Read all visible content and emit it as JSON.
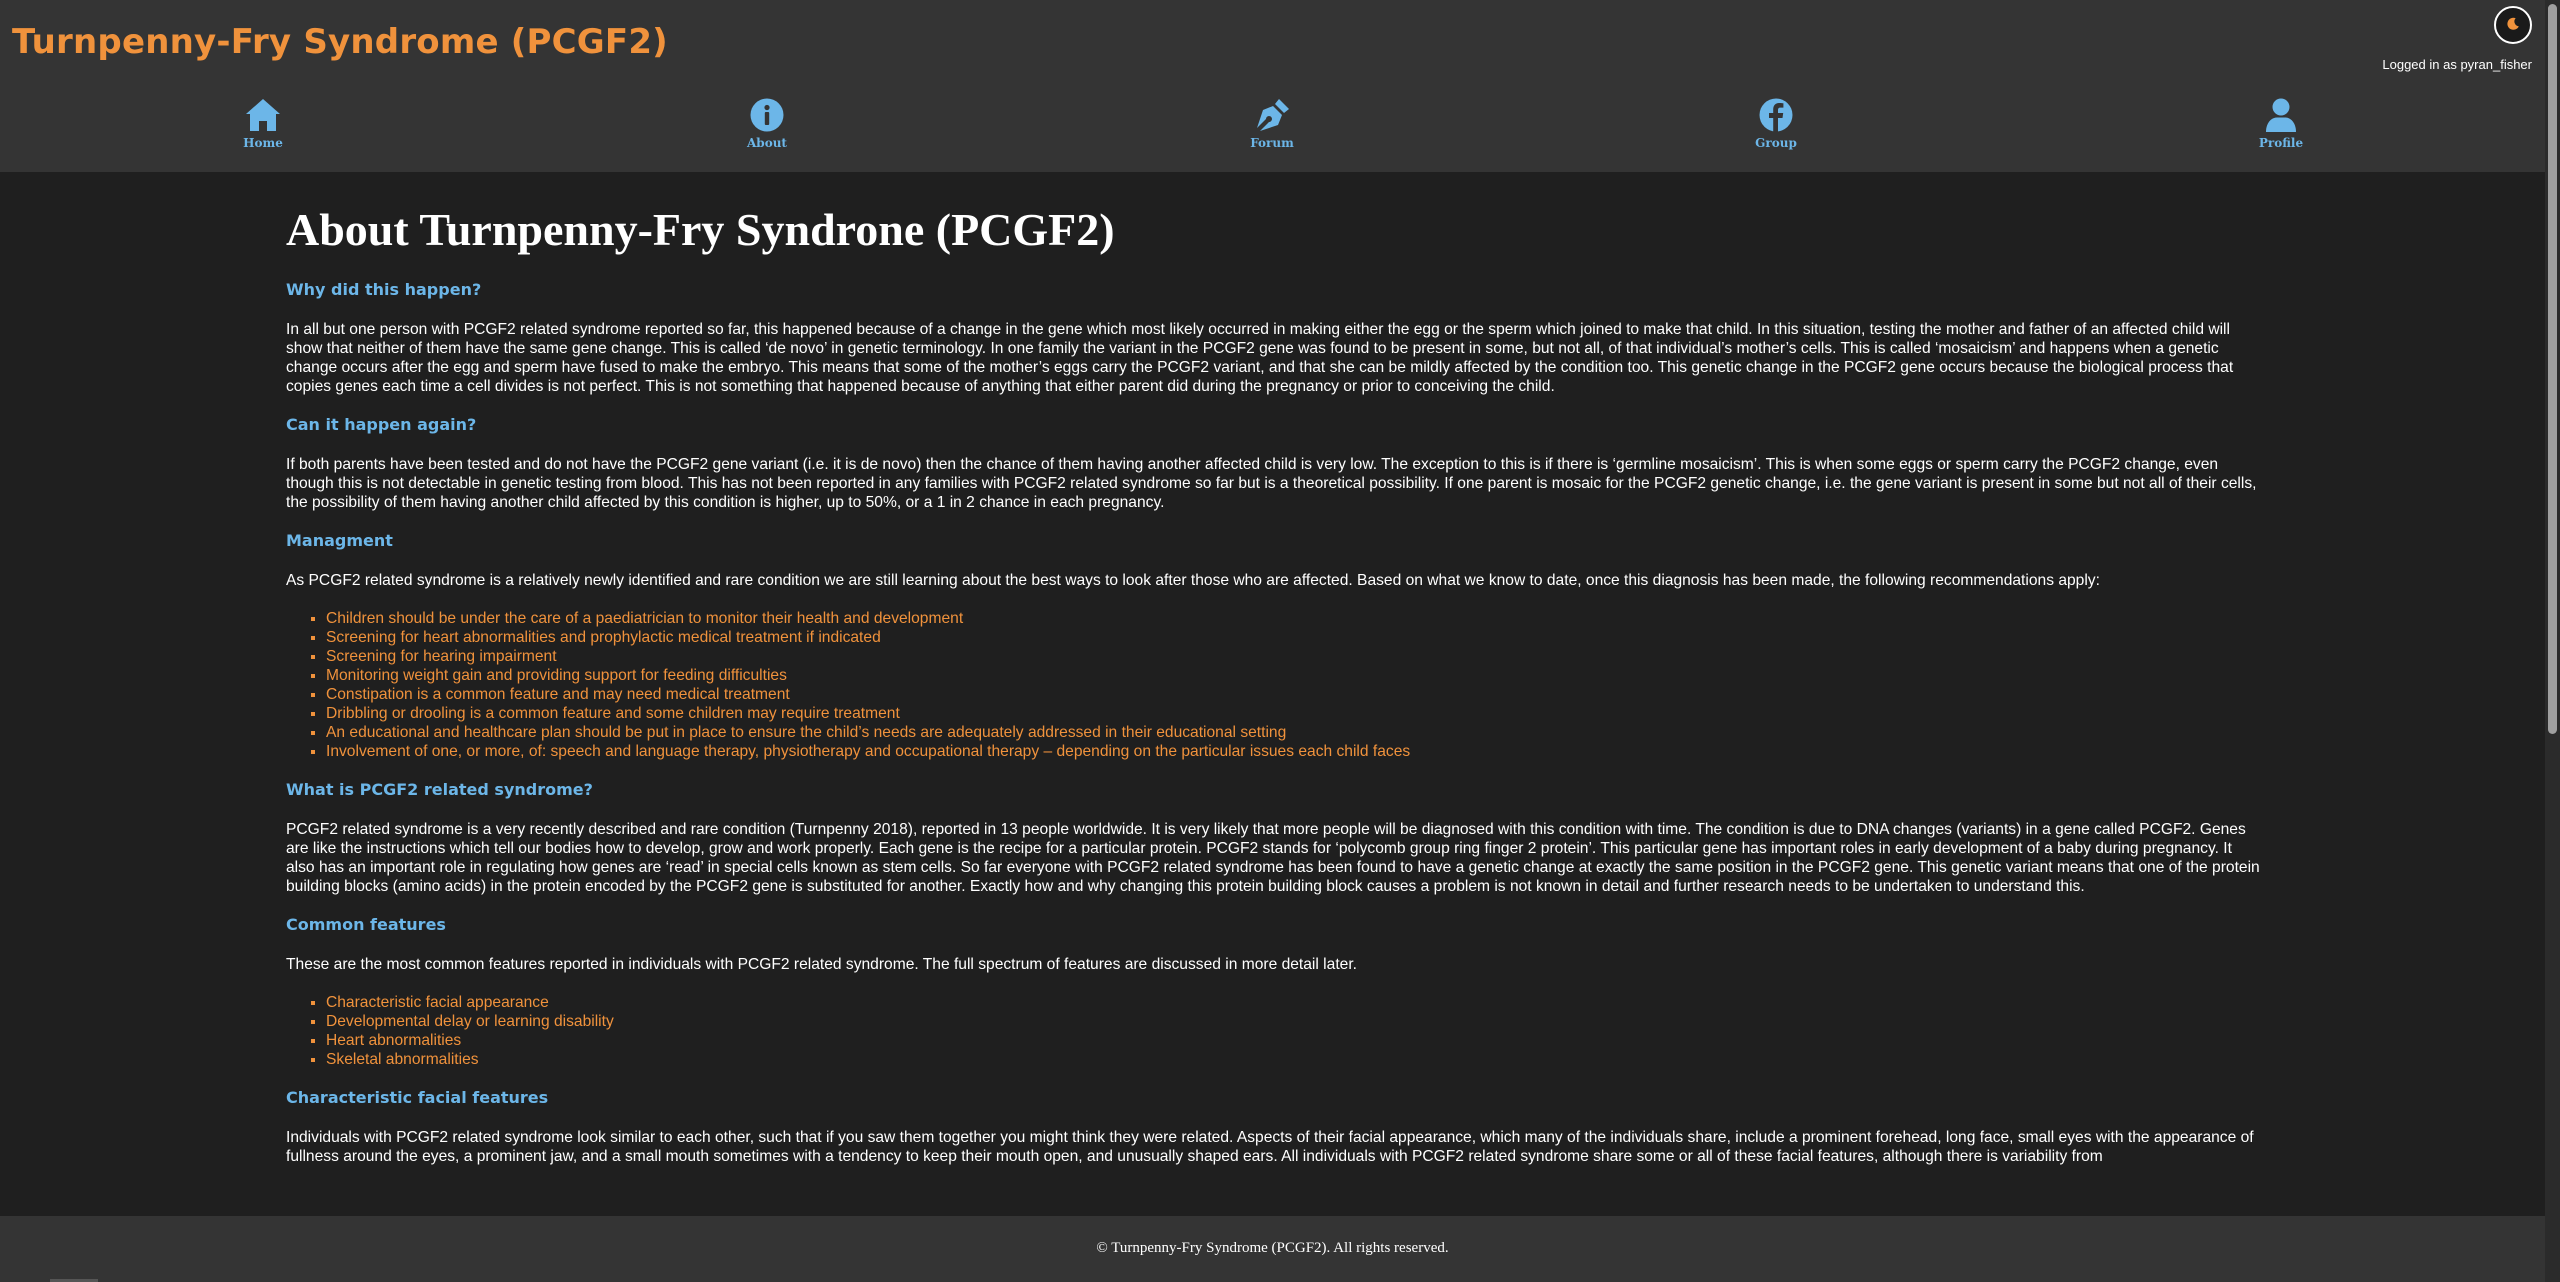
{
  "site": {
    "title": "Turnpenny-Fry Syndrome (PCGF2)",
    "logged_in_text": "Logged in as pyran_fisher",
    "theme_toggle_icon": "moon-icon",
    "accent_color": "#f0923c",
    "link_color": "#6cb6e8"
  },
  "nav": {
    "items": [
      {
        "label": "Home",
        "icon": "home-icon"
      },
      {
        "label": "About",
        "icon": "info-icon"
      },
      {
        "label": "Forum",
        "icon": "pen-nib-icon"
      },
      {
        "label": "Group",
        "icon": "facebook-icon"
      },
      {
        "label": "Profile",
        "icon": "user-icon"
      }
    ]
  },
  "page": {
    "title": "About Turnpenny-Fry Syndrone (PCGF2)",
    "sections": {
      "why": {
        "heading": "Why did this happen?",
        "text": "In all but one person with PCGF2 related syndrome reported so far, this happened because of a change in the gene which most likely occurred in making either the egg or the sperm which joined to make that child. In this situation, testing the mother and father of an affected child will show that neither of them have the same gene change. This is called ‘de novo’ in genetic terminology. In one family the variant in the PCGF2 gene was found to be present in some, but not all, of that individual’s mother’s cells. This is called ‘mosaicism’ and happens when a genetic change occurs after the egg and sperm have fused to make the embryo. This means that some of the mother’s eggs carry the PCGF2 variant, and that she can be mildly affected by the condition too. This genetic change in the PCGF2 gene occurs because the biological process that copies genes each time a cell divides is not perfect. This is not something that happened because of anything that either parent did during the pregnancy or prior to conceiving the child."
      },
      "again": {
        "heading": "Can it happen again?",
        "text": "If both parents have been tested and do not have the PCGF2 gene variant (i.e. it is de novo) then the chance of them having another affected child is very low. The exception to this is if there is ‘germline mosaicism’. This is when some eggs or sperm carry the PCGF2 change, even though this is not detectable in genetic testing from blood. This has not been reported in any families with PCGF2 related syndrome so far but is a theoretical possibility. If one parent is mosaic for the PCGF2 genetic change, i.e. the gene variant is present in some but not all of their cells, the possibility of them having another child affected by this condition is higher, up to 50%, or a 1 in 2 chance in each pregnancy."
      },
      "management": {
        "heading": "Managment",
        "text": "As PCGF2 related syndrome is a relatively newly identified and rare condition we are still learning about the best ways to look after those who are affected. Based on what we know to date, once this diagnosis has been made, the following recommendations apply:",
        "items": [
          "Children should be under the care of a paediatrician to monitor their health and development",
          "Screening for heart abnormalities and prophylactic medical treatment if indicated",
          "Screening for hearing impairment",
          "Monitoring weight gain and providing support for feeding difficulties",
          "Constipation is a common feature and may need medical treatment",
          "Dribbling or drooling is a common feature and some children may require treatment",
          "An educational and healthcare plan should be put in place to ensure the child’s needs are adequately addressed in their educational setting",
          "Involvement of one, or more, of: speech and language therapy, physiotherapy and occupational therapy – depending on the particular issues each child faces"
        ]
      },
      "what": {
        "heading": "What is PCGF2 related syndrome?",
        "text": "PCGF2 related syndrome is a very recently described and rare condition (Turnpenny 2018), reported in 13 people worldwide. It is very likely that more people will be diagnosed with this condition with time. The condition is due to DNA changes (variants) in a gene called PCGF2. Genes are like the instructions which tell our bodies how to develop, grow and work properly. Each gene is the recipe for a particular protein. PCGF2 stands for ‘polycomb group ring finger 2 protein’. This particular gene has important roles in early development of a baby during pregnancy. It also has an important role in regulating how genes are ‘read’ in special cells known as stem cells. So far everyone with PCGF2 related syndrome has been found to have a genetic change at exactly the same position in the PCGF2 gene. This genetic variant means that one of the protein building blocks (amino acids) in the protein encoded by the PCGF2 gene is substituted for another. Exactly how and why changing this protein building block causes a problem is not known in detail and further research needs to be undertaken to understand this."
      },
      "common": {
        "heading": "Common features",
        "text": "These are the most common features reported in individuals with PCGF2 related syndrome. The full spectrum of features are discussed in more detail later.",
        "items": [
          "Characteristic facial appearance",
          "Developmental delay or learning disability",
          "Heart abnormalities",
          "Skeletal abnormalities"
        ]
      },
      "facial": {
        "heading": "Characteristic facial features",
        "text": "Individuals with PCGF2 related syndrome look similar to each other, such that if you saw them together you might think they were related. Aspects of their facial appearance, which many of the individuals share, include a prominent forehead, long face, small eyes with the appearance of fullness around the eyes, a prominent jaw, and a small mouth sometimes with a tendency to keep their mouth open, and unusually shaped ears. All individuals with PCGF2 related syndrome share some or all of these facial features, although there is variability from"
      }
    }
  },
  "footer": {
    "copyright": "© Turnpenny-Fry Syndrome (PCGF2). All rights reserved."
  }
}
